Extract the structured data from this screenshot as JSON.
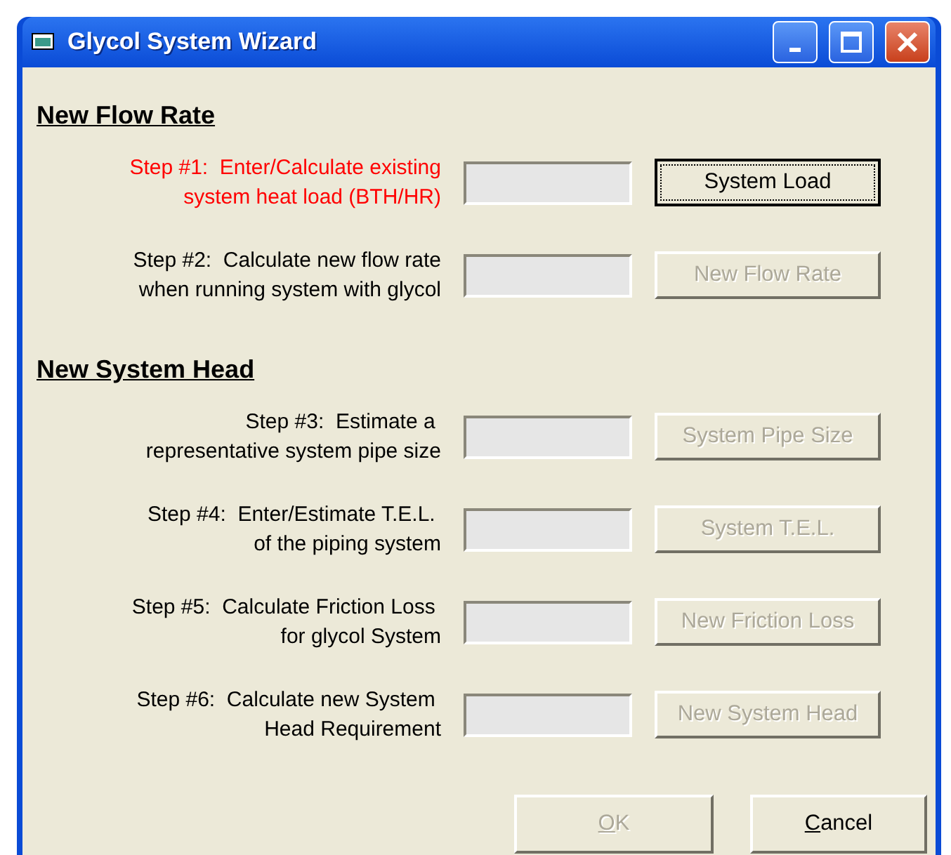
{
  "window": {
    "title": "Glycol System Wizard"
  },
  "sections": [
    {
      "heading": "New Flow Rate",
      "steps": [
        {
          "label": "Step #1:  Enter/Calculate existing\nsystem heat load (BTH/HR)",
          "active": true,
          "button": {
            "label": "System Load",
            "disabled": false,
            "focused": true
          }
        },
        {
          "label": "Step #2:  Calculate new flow rate\nwhen running system with glycol",
          "active": false,
          "button": {
            "label": "New Flow Rate",
            "disabled": true,
            "focused": false
          }
        }
      ]
    },
    {
      "heading": "New System Head",
      "steps": [
        {
          "label": "Step #3:  Estimate a \nrepresentative system pipe size",
          "active": false,
          "button": {
            "label": "System Pipe Size",
            "disabled": true,
            "focused": false
          }
        },
        {
          "label": "Step #4:  Enter/Estimate T.E.L. \nof the piping system",
          "active": false,
          "button": {
            "label": "System T.E.L.",
            "disabled": true,
            "focused": false
          }
        },
        {
          "label": "Step #5:  Calculate Friction Loss \nfor glycol System",
          "active": false,
          "button": {
            "label": "New Friction Loss",
            "disabled": true,
            "focused": false
          }
        },
        {
          "label": "Step #6:  Calculate new System \nHead Requirement",
          "active": false,
          "button": {
            "label": "New System Head",
            "disabled": true,
            "focused": false
          }
        }
      ]
    }
  ],
  "footer_buttons": [
    {
      "label": "OK",
      "disabled": true,
      "mnemonic": true
    },
    {
      "label": "Cancel",
      "disabled": false,
      "mnemonic": true
    }
  ]
}
